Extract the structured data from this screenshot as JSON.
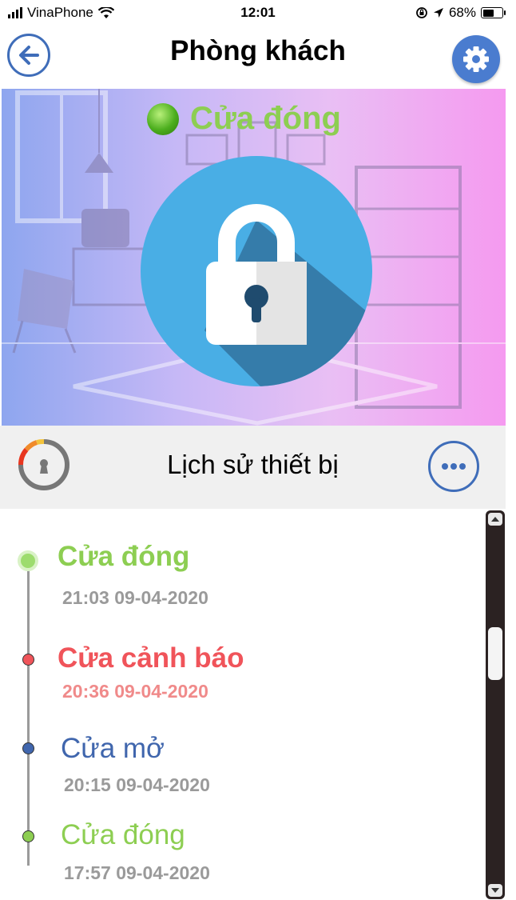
{
  "status_bar": {
    "carrier": "VinaPhone",
    "time": "12:01",
    "battery": "68%",
    "battery_level": 0.68
  },
  "header": {
    "title": "Phòng khách",
    "back_icon": "arrow-left-icon",
    "settings_icon": "gear-icon"
  },
  "banner": {
    "status_text": "Cửa đóng",
    "status_color": "#8dce52",
    "lock_icon": "padlock-icon"
  },
  "history": {
    "title": "Lịch sử thiết bị",
    "more_icon": "ellipsis-icon",
    "entries": [
      {
        "label": "Cửa đóng",
        "time": "21:03 09-04-2020",
        "color": "#8dce52",
        "time_color": "#9a9a9a"
      },
      {
        "label": "Cửa cảnh báo",
        "time": "20:36 09-04-2020",
        "color": "#f0545a",
        "time_color": "#f08a8a"
      },
      {
        "label": "Cửa mở",
        "time": "20:15 09-04-2020",
        "color": "#4066ad",
        "time_color": "#9a9a9a"
      },
      {
        "label": "Cửa đóng",
        "time": "17:57 09-04-2020",
        "color": "#8dce52",
        "time_color": "#9a9a9a"
      }
    ]
  },
  "colors": {
    "accent_blue": "#3f6db9",
    "lock_blue": "#49aee5"
  }
}
